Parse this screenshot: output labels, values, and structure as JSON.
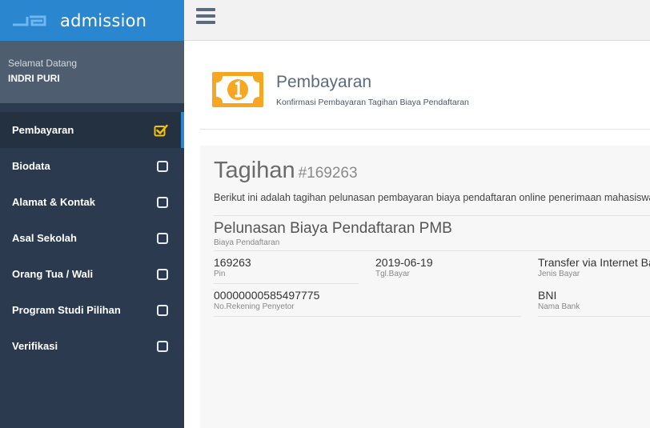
{
  "app": {
    "name": "admission"
  },
  "user": {
    "welcome": "Selamat Datang",
    "name": "INDRI PURI"
  },
  "sidebar": {
    "items": [
      {
        "label": "Pembayaran",
        "done": true
      },
      {
        "label": "Biodata",
        "done": false
      },
      {
        "label": "Alamat & Kontak",
        "done": false
      },
      {
        "label": "Asal Sekolah",
        "done": false
      },
      {
        "label": "Orang Tua / Wali",
        "done": false
      },
      {
        "label": "Program Studi Pilihan",
        "done": false
      },
      {
        "label": "Verifikasi",
        "done": false
      }
    ]
  },
  "header": {
    "title": "Pembayaran",
    "subtitle": "Konfirmasi Pembayaran Tagihan Biaya Pendaftaran"
  },
  "invoice": {
    "title": "Tagihan",
    "number": "#169263",
    "description": "Berikut ini adalah tagihan pelunasan pembayaran biaya pendaftaran online penerimaan mahasiswa baru",
    "item_value": "Pelunasan Biaya Pendaftaran PMB",
    "item_label": "Biaya Pendaftaran",
    "pin_value": "169263",
    "pin_label": "Pin",
    "date_value": "2019-06-19",
    "date_label": "Tgl.Bayar",
    "method_value": "Transfer via Internet Banking",
    "method_label": "Jenis Bayar",
    "account_value": "00000000585497775",
    "account_label": "No.Rekening Penyetor",
    "bank_value": "BNI",
    "bank_label": "Nama Bank"
  },
  "colors": {
    "brand": "#2a86cf",
    "sidebar": "#2b3a4e",
    "check_done": "#f5c400",
    "money_icon": "#f5a623"
  }
}
